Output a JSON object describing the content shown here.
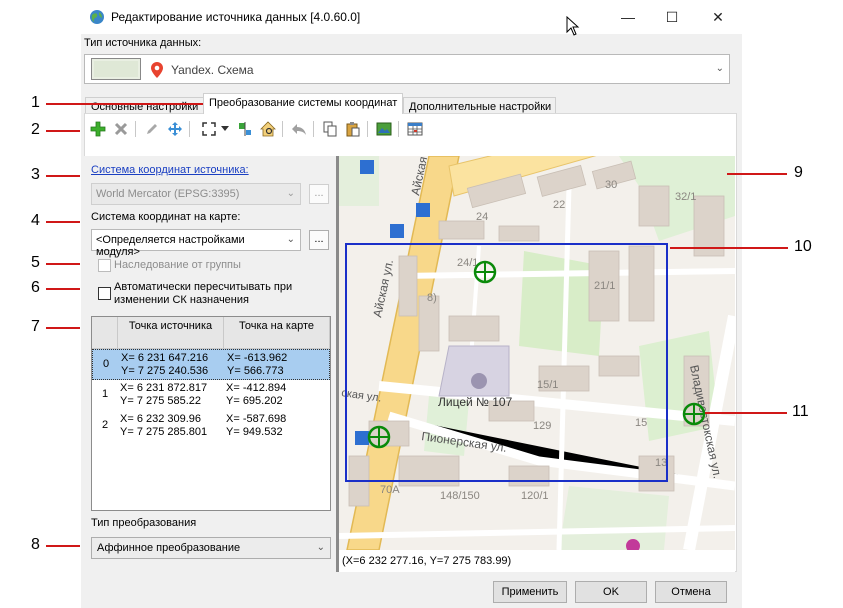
{
  "window": {
    "title": "Редактирование источника данных [4.0.60.0]",
    "minimize": "—",
    "maximize": "☐",
    "close": "✕"
  },
  "source_type": {
    "label": "Тип источника данных:",
    "value": "Yandex. Схема"
  },
  "tabs": [
    {
      "label": "Основные настройки"
    },
    {
      "label": "Преобразование системы координат"
    },
    {
      "label": "Дополнительные настройки"
    }
  ],
  "toolbar": {
    "icons": [
      "add-icon",
      "delete-icon",
      "edit-icon",
      "move-icon",
      "fit-extent-icon",
      "dropdown-arrow-icon",
      "split-icon",
      "zoom-home-icon",
      "undo-icon",
      "copy-icon",
      "paste-icon",
      "export-image-icon",
      "table-icon"
    ]
  },
  "left": {
    "source_cs_label": "Система координат источника:",
    "source_cs_value": "World Mercator (EPSG:3395)",
    "map_cs_label": "Система координат на карте:",
    "map_cs_value": "<Определяется настройками модуля>",
    "ellipsis": "...",
    "inherit_label": "Наследование от группы",
    "auto_recalc_label": "Автоматически пересчитывать при изменении СК назначения",
    "transform_type_label": "Тип преобразования",
    "transform_type_value": "Аффинное преобразование"
  },
  "grid": {
    "col1": "Точка источника",
    "col2": "Точка на карте",
    "rows": [
      {
        "n": "0",
        "sx": "X= 6 231 647.216",
        "sy": "Y= 7 275 240.536",
        "mx": "X= -613.962",
        "my": "Y= 566.773"
      },
      {
        "n": "1",
        "sx": "X= 6 231 872.817",
        "sy": "Y= 7 275 585.22",
        "mx": "X= -412.894",
        "my": "Y= 695.202"
      },
      {
        "n": "2",
        "sx": "X= 6 232 309.96",
        "sy": "Y= 7 275 285.801",
        "mx": "X= -587.698",
        "my": "Y= 949.532"
      }
    ]
  },
  "map": {
    "labels": {
      "aiskaya1": "Айская ул.",
      "aiskaya2": "Айская ул.",
      "vladivostok": "Владивостокская ул.",
      "pionerskaya": "Пионерская ул.",
      "tsaya": "ская ул.",
      "lyceum": "Лицей № 107",
      "n24": "24",
      "n24_1": "24/1",
      "n22": "22",
      "n30": "30",
      "n32_1": "32/1",
      "n21_1": "21/1",
      "n15_1": "15/1",
      "n129": "129",
      "n15": "15",
      "n13": "13",
      "n70a": "70А",
      "n148": "148/150",
      "n120": "120/1",
      "n8": "8)"
    }
  },
  "status": {
    "coords": "(X=6 232 277.16, Y=7 275 783.99)"
  },
  "buttons": {
    "apply": "Применить",
    "ok": "OK",
    "cancel": "Отмена"
  },
  "callouts": [
    "1",
    "2",
    "3",
    "4",
    "5",
    "6",
    "7",
    "8",
    "9",
    "10",
    "11"
  ],
  "colors": {
    "callout_line": "#d01818",
    "frame": "#1a2fc8",
    "marker": "#0a8a0a",
    "selection": "#a8cdf0"
  }
}
